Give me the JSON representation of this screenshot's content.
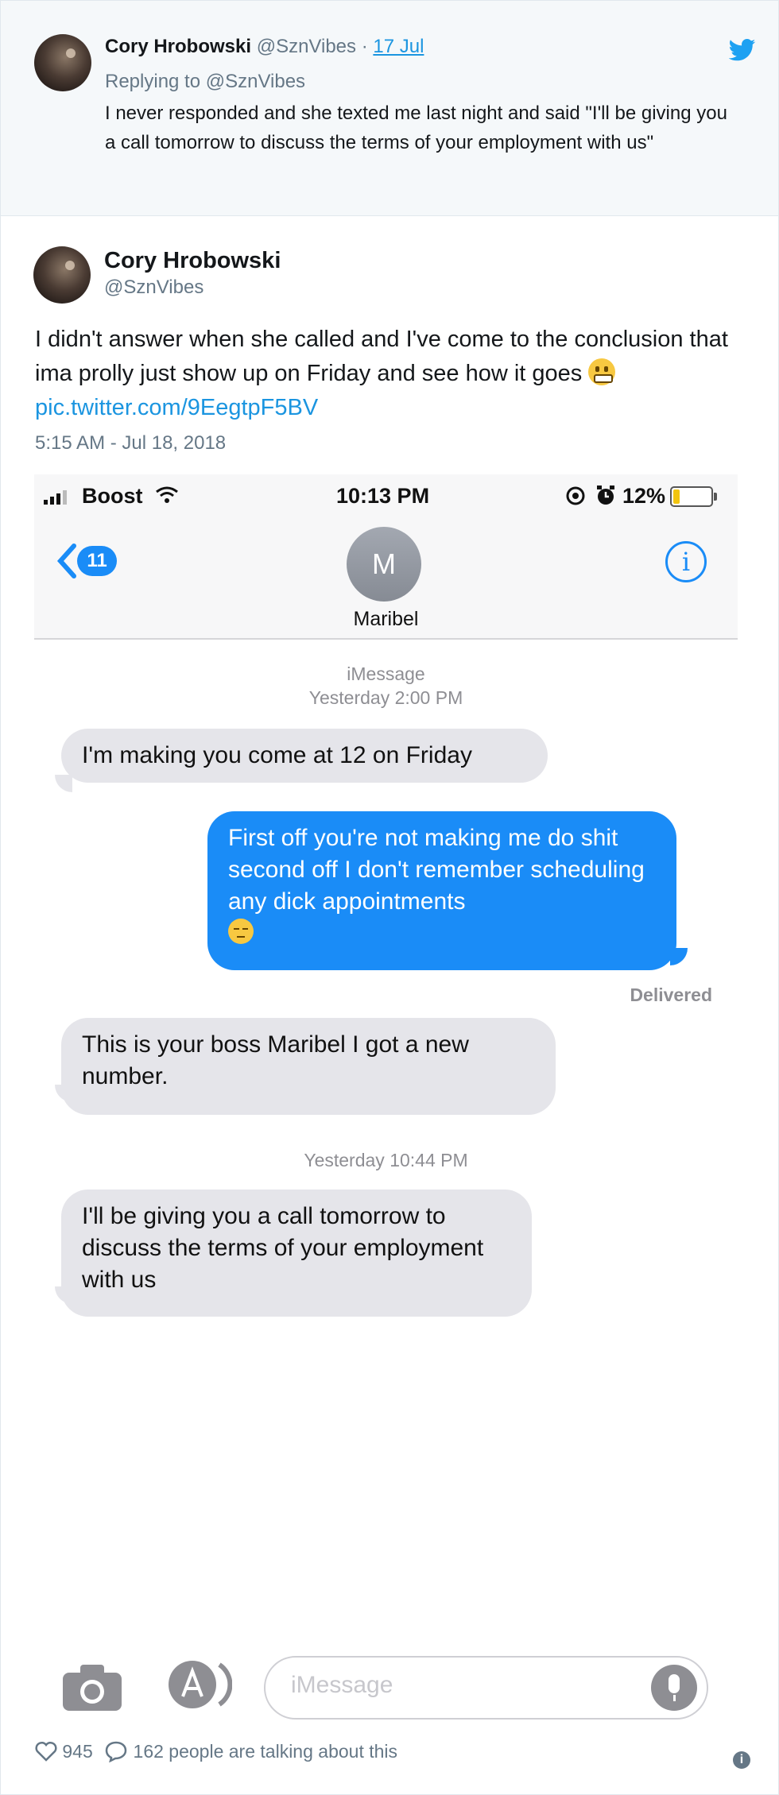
{
  "reply_tweet": {
    "author_name": "Cory Hrobowski",
    "handle": "@SznVibes",
    "separator": "·",
    "date": "17 Jul",
    "replying_to": "Replying to @SznVibes",
    "text": "I never responded and she texted me last night and said \"I'll be giving you a call tomorrow to discuss the terms of your employment with us\""
  },
  "main_tweet": {
    "author_name": "Cory Hrobowski",
    "handle": "@SznVibes",
    "text": "I didn't answer when she called and I've come to the conclusion that ima prolly just show up on Friday and see how it goes",
    "link": "pic.twitter.com/9EegtpF5BV",
    "timestamp": "5:15 AM - Jul 18, 2018"
  },
  "phone": {
    "carrier": "Boost",
    "time": "10:13 PM",
    "battery": "12%",
    "back_count": "11",
    "contact_initial": "M",
    "contact_name": "Maribel",
    "info_glyph": "i",
    "service_label": "iMessage",
    "timestamp1": "Yesterday 2:00 PM",
    "msg1": "I'm making you come at 12 on Friday",
    "msg2": "First off you're not making me do shit second off I don't remember scheduling any dick appointments",
    "delivered": "Delivered",
    "msg3": "This is your boss Maribel I got a new number.",
    "timestamp2": "Yesterday 10:44 PM",
    "msg4": "I'll be giving you a call tomorrow to discuss the terms of your employment with us",
    "input_placeholder": "iMessage"
  },
  "footer": {
    "likes": "945",
    "talking": "162 people are talking about this"
  },
  "colors": {
    "twitter_blue": "#1da1f2",
    "imessage_blue": "#1a8cf7",
    "received_gray": "#e5e5ea"
  },
  "icons": [
    "twitter-bird-icon",
    "signal-icon",
    "wifi-icon",
    "at-lock-icon",
    "alarm-icon",
    "battery-icon",
    "back-chevron-icon",
    "info-icon",
    "camera-icon",
    "appstore-icon",
    "microphone-icon",
    "heart-icon",
    "comment-icon",
    "info-circle-icon"
  ]
}
